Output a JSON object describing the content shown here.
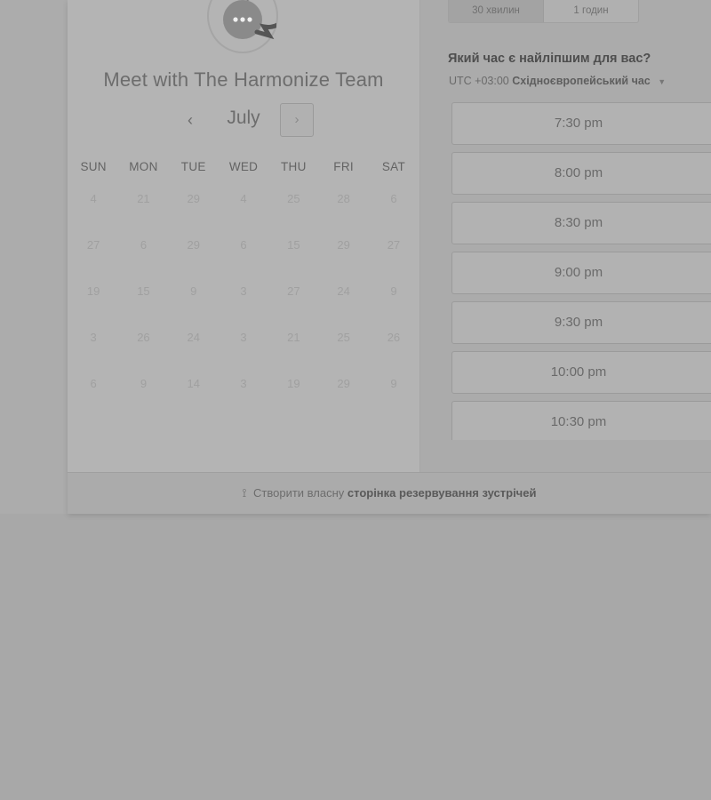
{
  "header": {
    "title": "Meet with The Harmonize Team"
  },
  "calendar": {
    "month": "July",
    "prev_label": "‹",
    "next_label": "›",
    "weekdays": [
      "SUN",
      "MON",
      "TUE",
      "WED",
      "THU",
      "FRI",
      "SAT"
    ],
    "weeks": [
      [
        "4",
        "21",
        "29",
        "4",
        "25",
        "28",
        "6"
      ],
      [
        "27",
        "6",
        "29",
        "6",
        "15",
        "29",
        "27"
      ],
      [
        "19",
        "15",
        "9",
        "3",
        "27",
        "24",
        "9"
      ],
      [
        "3",
        "26",
        "24",
        "3",
        "21",
        "25",
        "26"
      ],
      [
        "6",
        "9",
        "14",
        "3",
        "19",
        "29",
        "9"
      ]
    ]
  },
  "duration": {
    "options": [
      "30 хвилин",
      "1 годин"
    ],
    "selected": "30 хвилин"
  },
  "time_picker": {
    "question": "Який час є найліпшим для вас?",
    "timezone_offset": "UTC +03:00",
    "timezone_name": "Східноєвропейський час",
    "slots": [
      "7:30 pm",
      "8:00 pm",
      "8:30 pm",
      "9:00 pm",
      "9:30 pm",
      "10:00 pm",
      "10:30 pm"
    ]
  },
  "footer": {
    "prefix": "Створити власну",
    "link": "сторінка резервування зустрічей",
    "icon": "hubspot-sprocket-icon"
  },
  "colors": {
    "overlay_gray": "#a8a8a8",
    "panel_gray": "#b4b4b4"
  }
}
